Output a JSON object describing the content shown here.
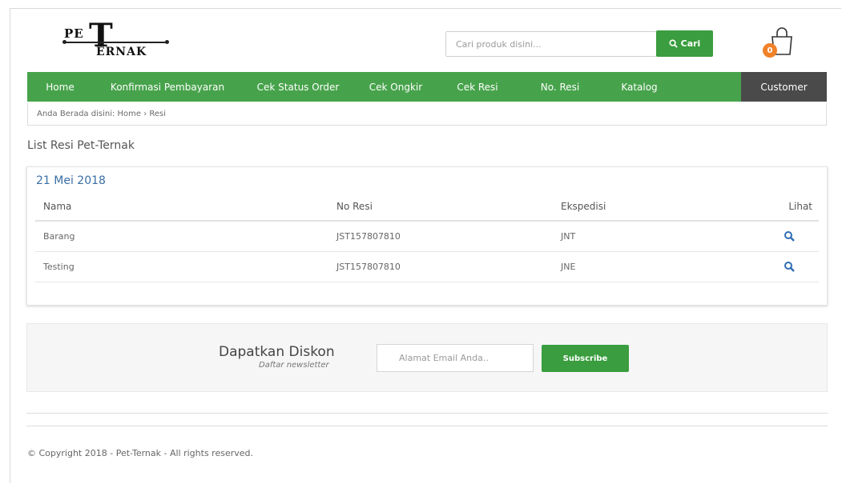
{
  "brand": {
    "logo_text_top": "PE",
    "logo_text_big": "T",
    "logo_text_bottom": "ERNAK"
  },
  "search": {
    "placeholder": "Cari produk disini...",
    "button_label": "Cari",
    "icon": "search-icon"
  },
  "cart": {
    "count": "0",
    "icon": "shopping-bag-icon"
  },
  "nav": {
    "items": [
      {
        "label": "Home"
      },
      {
        "label": "Konfirmasi Pembayaran"
      },
      {
        "label": "Cek Status Order"
      },
      {
        "label": "Cek Ongkir"
      },
      {
        "label": "Cek Resi"
      },
      {
        "label": "No. Resi"
      },
      {
        "label": "Katalog"
      }
    ],
    "customer_label": "Customer"
  },
  "breadcrumb": {
    "text": "Anda Berada disini: Home › Resi"
  },
  "page": {
    "title": "List Resi Pet-Ternak"
  },
  "resi": {
    "date": "21 Mei 2018",
    "headers": {
      "nama": "Nama",
      "no_resi": "No Resi",
      "ekspedisi": "Ekspedisi",
      "lihat": "Lihat"
    },
    "rows": [
      {
        "nama": "Barang",
        "no_resi": "JST157807810",
        "ekspedisi": "JNT"
      },
      {
        "nama": "Testing",
        "no_resi": "JST157807810",
        "ekspedisi": "JNE"
      }
    ]
  },
  "newsletter": {
    "title": "Dapatkan Diskon",
    "subtitle": "Daftar newsletter",
    "placeholder": "Alamat Email Anda..",
    "button_label": "Subscribe"
  },
  "footer": {
    "copyright": "© Copyright 2018 - Pet-Ternak - All rights reserved."
  },
  "colors": {
    "primary_green": "#47a34b",
    "button_green": "#3a9d3f",
    "customer_dark": "#4a4a4a",
    "badge_orange": "#f0822a",
    "link_blue": "#3a6ea5"
  }
}
